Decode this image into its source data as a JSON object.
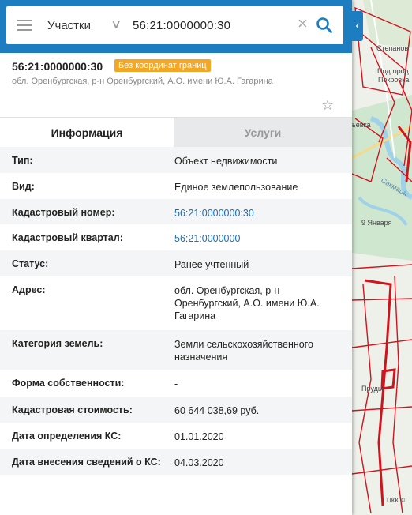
{
  "search": {
    "type_label": "Участки",
    "value": "56:21:0000000:30"
  },
  "object": {
    "number": "56:21:0000000:30",
    "badge": "Без координат границ",
    "address": "обл. Оренбургская, р-н Оренбургский, А.О. имени Ю.А. Гагарина"
  },
  "tabs": {
    "info": "Информация",
    "services": "Услуги"
  },
  "rows": [
    {
      "label": "Тип:",
      "value": "Объект недвижимости"
    },
    {
      "label": "Вид:",
      "value": "Единое землепользование"
    },
    {
      "label": "Кадастровый номер:",
      "value": "56:21:0000000:30"
    },
    {
      "label": "Кадастровый квартал:",
      "value": "56:21:0000000"
    },
    {
      "label": "Статус:",
      "value": "Ранее учтенный"
    },
    {
      "label": "Адрес:",
      "value": "обл. Оренбургская, р-н Оренбургский, А.О. имени Ю.А. Гагарина"
    },
    {
      "label": "Категория земель:",
      "value": "Земли сельскохозяйственного назначения"
    },
    {
      "label": "Форма собственности:",
      "value": "-"
    },
    {
      "label": "Кадастровая стоимость:",
      "value": "60 644 038,69 руб."
    },
    {
      "label": "Дата определения КС:",
      "value": "01.01.2020"
    },
    {
      "label": "Дата внесения сведений о КС:",
      "value": "04.03.2020"
    }
  ],
  "map": {
    "labels": [
      "Степанов",
      "Подгород",
      "Покровка",
      "ьевка",
      "Сакмара",
      "9 Января",
      "Пруды",
      "ПКК ©"
    ]
  },
  "colors": {
    "accent": "#1c7ec1",
    "badge": "#f5a623",
    "link": "#1c6fb4",
    "parcel": "#d0141e"
  }
}
